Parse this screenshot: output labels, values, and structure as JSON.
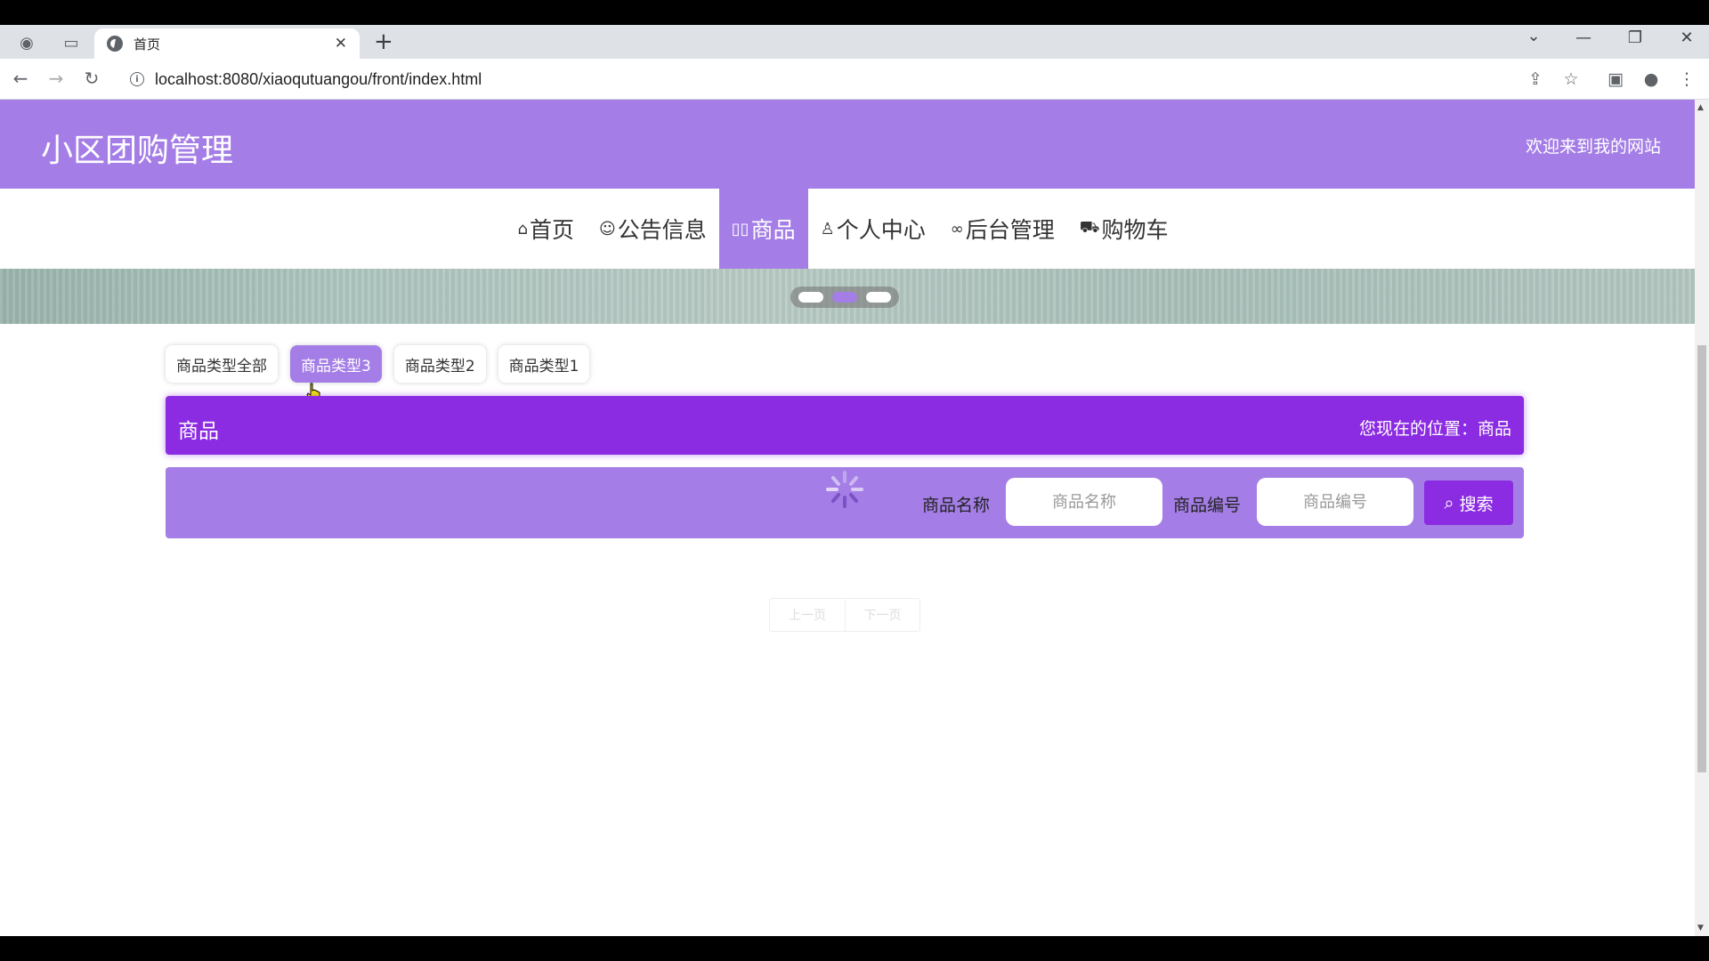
{
  "browser": {
    "tab_title": "首页",
    "new_tab_label": "+",
    "url": "localhost:8080/xiaoqutuangou/front/index.html"
  },
  "site": {
    "title": "小区团购管理",
    "welcome": "欢迎来到我的网站",
    "accent": "#a47ee6",
    "accent_dark": "#8b2be2"
  },
  "nav": {
    "items": [
      {
        "icon": "home-icon",
        "label": "首页",
        "active": false
      },
      {
        "icon": "palette-icon",
        "label": "公告信息",
        "active": false
      },
      {
        "icon": "book-icon",
        "label": "商品",
        "active": true
      },
      {
        "icon": "user-icon",
        "label": "个人中心",
        "active": false
      },
      {
        "icon": "link-icon",
        "label": "后台管理",
        "active": false
      },
      {
        "icon": "cart-icon",
        "label": "购物车",
        "active": false
      }
    ]
  },
  "carousel": {
    "dots": 3,
    "active_index": 1
  },
  "type_tabs": [
    {
      "label": "商品类型全部",
      "active": false
    },
    {
      "label": "商品类型3",
      "active": true
    },
    {
      "label": "商品类型2",
      "active": false
    },
    {
      "label": "商品类型1",
      "active": false
    }
  ],
  "section": {
    "title": "商品",
    "location": "您现在的位置：商品"
  },
  "search": {
    "name_label": "商品名称",
    "name_placeholder": "商品名称",
    "code_label": "商品编号",
    "code_placeholder": "商品编号",
    "button_label": "搜索"
  },
  "pager": {
    "prev": "上一页",
    "next": "下一页"
  }
}
